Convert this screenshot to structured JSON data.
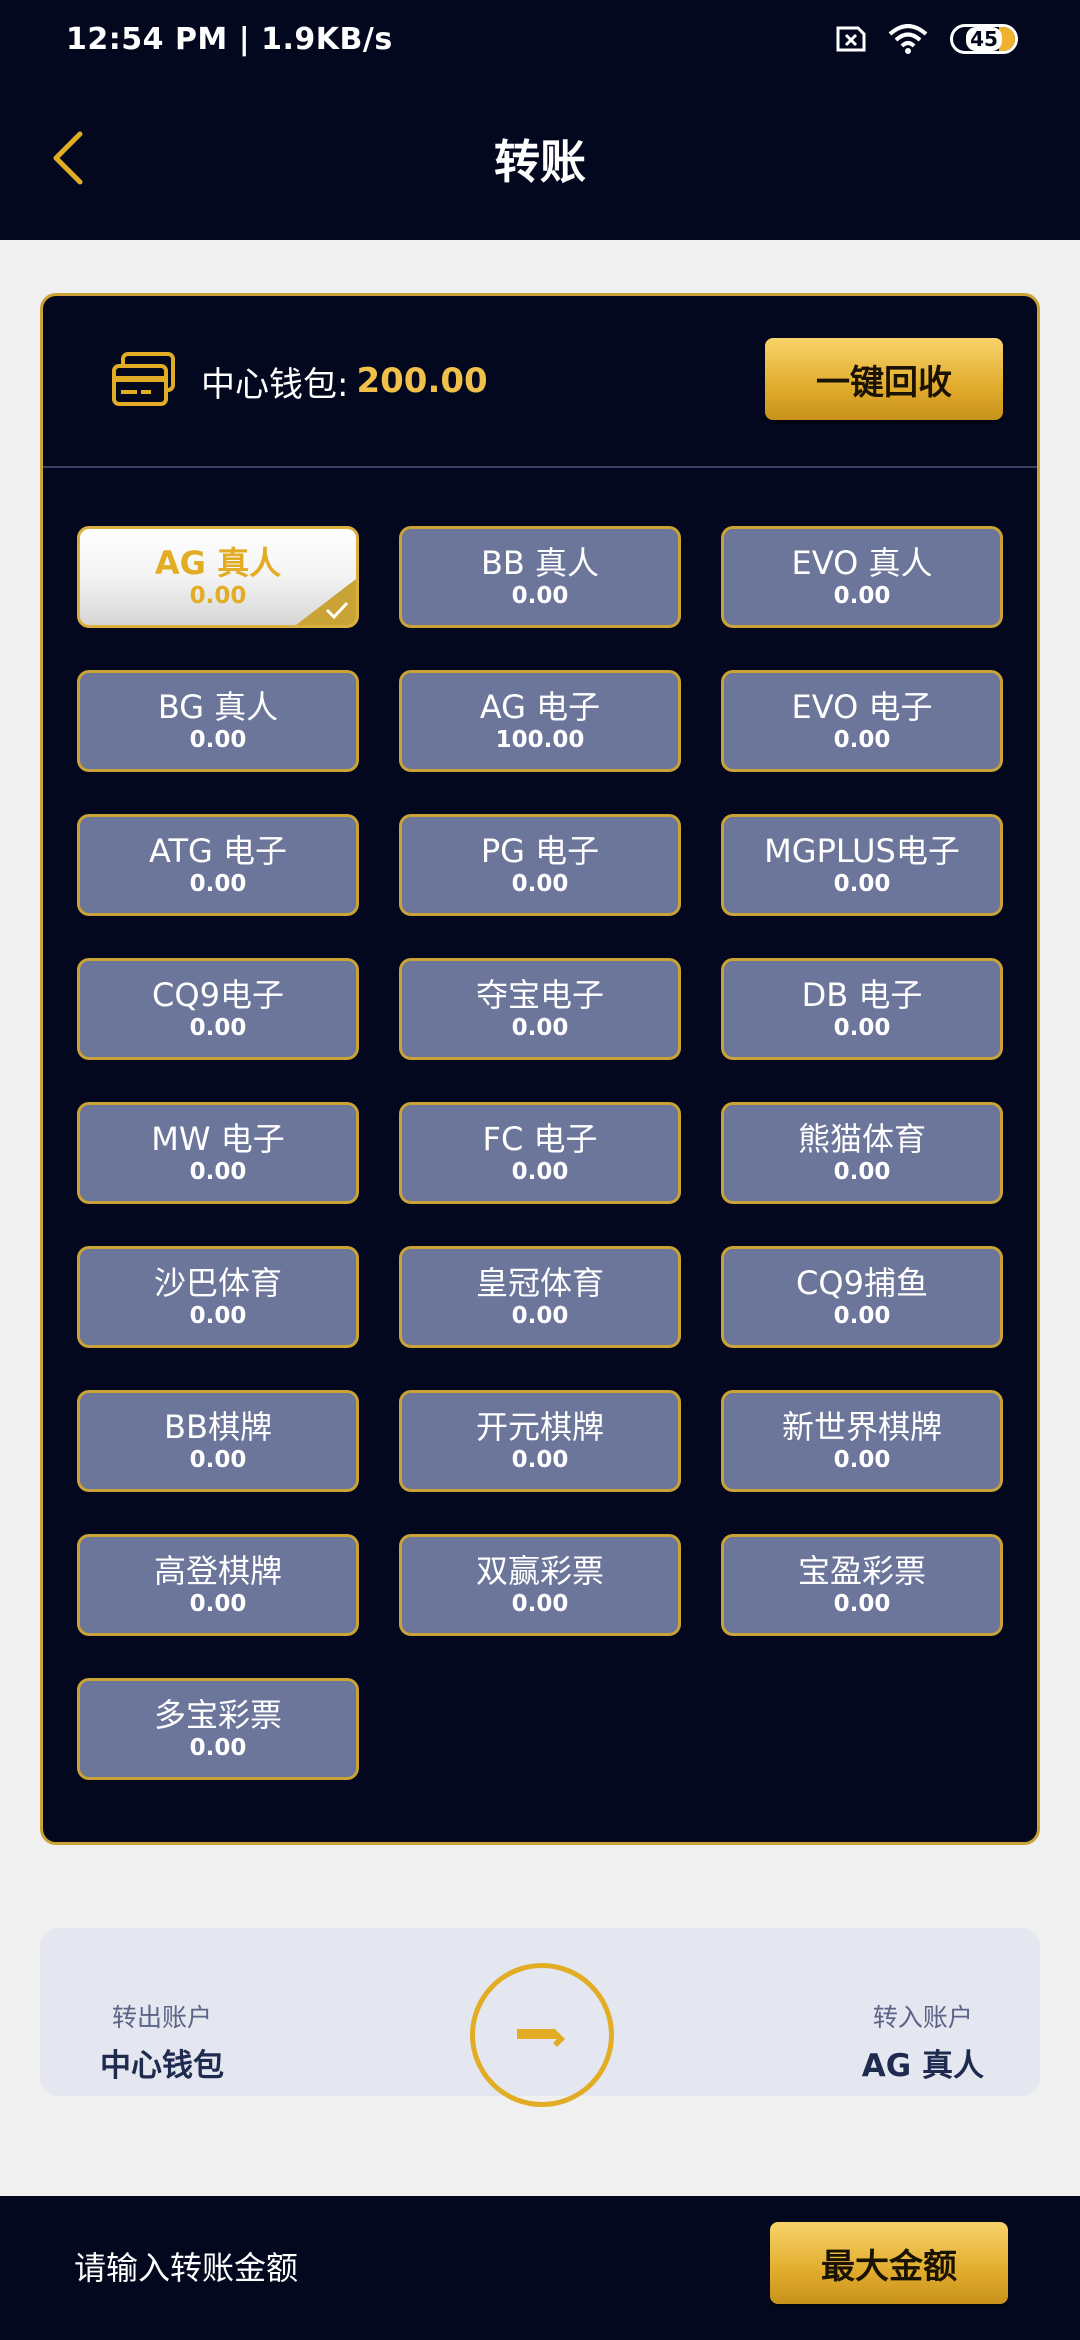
{
  "status_bar": {
    "time_speed": "12:54 PM | 1.9KB/s",
    "battery": "45",
    "icons": [
      "sim-error-icon",
      "wifi-icon",
      "battery-icon"
    ]
  },
  "header": {
    "title": "转账",
    "back_icon": "chevron-left-icon"
  },
  "wallet": {
    "label": "中心钱包: ",
    "amount": "200.00",
    "recycle_button": "一键回收"
  },
  "platforms": [
    {
      "name": "AG 真人",
      "balance": "0.00",
      "selected": true
    },
    {
      "name": "BB 真人",
      "balance": "0.00"
    },
    {
      "name": "EVO 真人",
      "balance": "0.00"
    },
    {
      "name": "BG 真人",
      "balance": "0.00"
    },
    {
      "name": "AG 电子",
      "balance": "100.00"
    },
    {
      "name": "EVO 电子",
      "balance": "0.00"
    },
    {
      "name": "ATG 电子",
      "balance": "0.00"
    },
    {
      "name": "PG 电子",
      "balance": "0.00"
    },
    {
      "name": "MGPLUS电子",
      "balance": "0.00"
    },
    {
      "name": "CQ9电子",
      "balance": "0.00"
    },
    {
      "name": "夺宝电子",
      "balance": "0.00"
    },
    {
      "name": "DB 电子",
      "balance": "0.00"
    },
    {
      "name": "MW 电子",
      "balance": "0.00"
    },
    {
      "name": "FC 电子",
      "balance": "0.00"
    },
    {
      "name": "熊猫体育",
      "balance": "0.00"
    },
    {
      "name": "沙巴体育",
      "balance": "0.00"
    },
    {
      "name": "皇冠体育",
      "balance": "0.00"
    },
    {
      "name": "CQ9捕鱼",
      "balance": "0.00"
    },
    {
      "name": "BB棋牌",
      "balance": "0.00"
    },
    {
      "name": "开元棋牌",
      "balance": "0.00"
    },
    {
      "name": "新世界棋牌",
      "balance": "0.00"
    },
    {
      "name": "高登棋牌",
      "balance": "0.00"
    },
    {
      "name": "双赢彩票",
      "balance": "0.00"
    },
    {
      "name": "宝盈彩票",
      "balance": "0.00"
    },
    {
      "name": "多宝彩票",
      "balance": "0.00"
    }
  ],
  "transfer": {
    "out_label": "转出账户",
    "out_account": "中心钱包",
    "in_label": "转入账户",
    "in_account": "AG 真人"
  },
  "footer": {
    "amount_placeholder": "请输入转账金额",
    "max_button": "最大金额"
  },
  "colors": {
    "background_dark": "#03081f",
    "gold_accent": "#e2ad24",
    "tile_bg": "#6c759a"
  }
}
